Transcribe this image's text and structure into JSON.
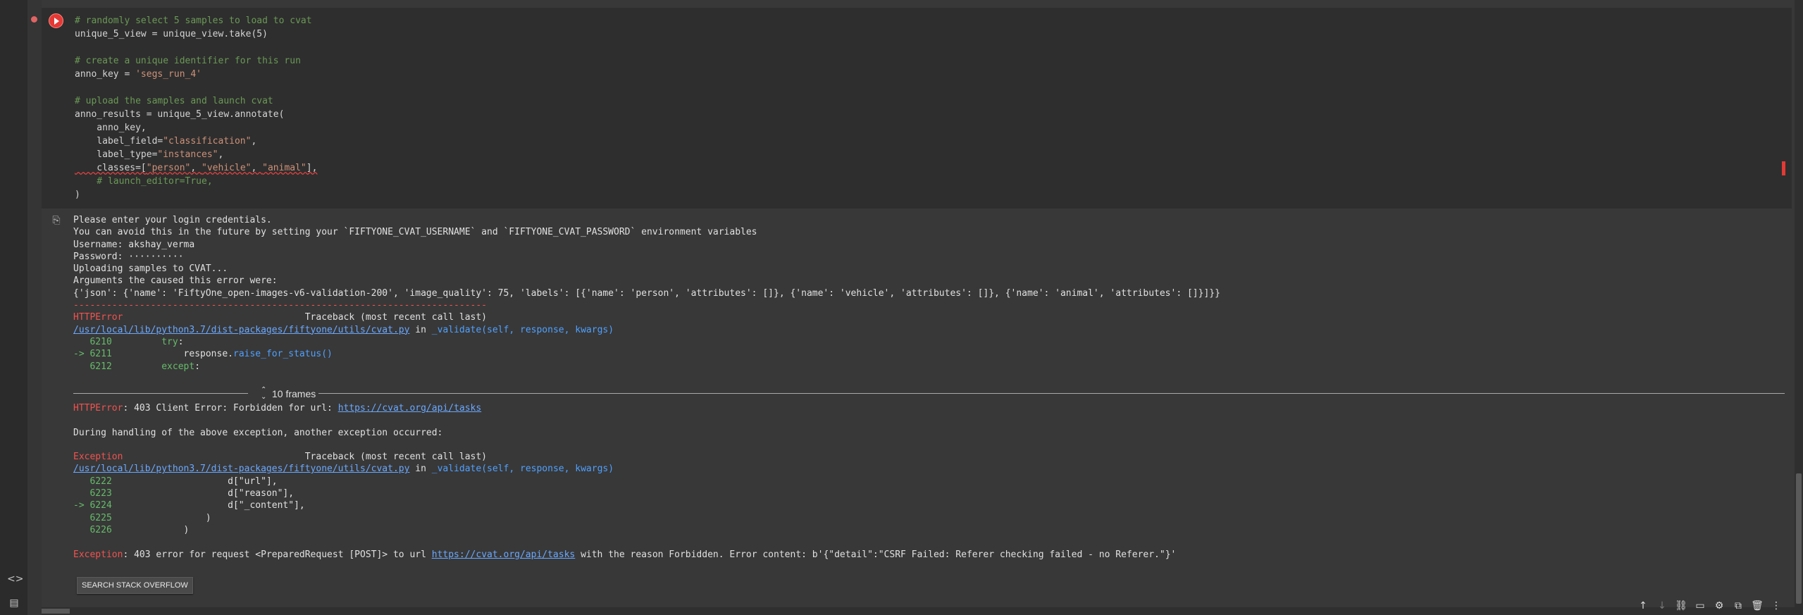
{
  "sidebar": {
    "icons": [
      "code-snippets-icon",
      "terminal-icon"
    ]
  },
  "cell": {
    "code_lines": [
      {
        "parts": [
          {
            "t": "# randomly select 5 samples to load to cvat",
            "c": "comment"
          }
        ]
      },
      {
        "parts": [
          {
            "t": "unique_5_view = unique_view.take(5)",
            "c": ""
          }
        ]
      },
      {
        "parts": [
          {
            "t": "",
            "c": ""
          }
        ]
      },
      {
        "parts": [
          {
            "t": "# create a unique identifier for this run",
            "c": "comment"
          }
        ]
      },
      {
        "parts": [
          {
            "t": "anno_key = ",
            "c": ""
          },
          {
            "t": "'segs_run_4'",
            "c": "str"
          }
        ]
      },
      {
        "parts": [
          {
            "t": "",
            "c": ""
          }
        ]
      },
      {
        "parts": [
          {
            "t": "# upload the samples and launch cvat",
            "c": "comment"
          }
        ]
      },
      {
        "parts": [
          {
            "t": "anno_results = unique_5_view.annotate(",
            "c": ""
          }
        ]
      },
      {
        "parts": [
          {
            "t": "    anno_key,",
            "c": ""
          }
        ]
      },
      {
        "parts": [
          {
            "t": "    label_field=",
            "c": ""
          },
          {
            "t": "\"classification\"",
            "c": "str"
          },
          {
            "t": ",",
            "c": ""
          }
        ]
      },
      {
        "parts": [
          {
            "t": "    label_type=",
            "c": ""
          },
          {
            "t": "\"instances\"",
            "c": "str"
          },
          {
            "t": ",",
            "c": ""
          }
        ]
      },
      {
        "parts": [
          {
            "t": "    classes=[",
            "c": "sq"
          },
          {
            "t": "\"person\"",
            "c": "sqstr"
          },
          {
            "t": ", ",
            "c": "sq"
          },
          {
            "t": "\"vehicle\"",
            "c": "sqstr"
          },
          {
            "t": ", ",
            "c": "sq"
          },
          {
            "t": "\"animal\"",
            "c": "sqstr"
          },
          {
            "t": "],",
            "c": "sq"
          }
        ]
      },
      {
        "parts": [
          {
            "t": "    # launch_editor=True,",
            "c": "comment"
          }
        ]
      },
      {
        "parts": [
          {
            "t": ")",
            "c": ""
          }
        ]
      }
    ]
  },
  "output": {
    "block1": [
      {
        "parts": [
          {
            "t": "Please enter your login credentials.",
            "c": ""
          }
        ]
      },
      {
        "parts": [
          {
            "t": "You can avoid this in the future by setting your `FIFTYONE_CVAT_USERNAME` and `FIFTYONE_CVAT_PASSWORD` environment variables",
            "c": ""
          }
        ]
      },
      {
        "parts": [
          {
            "t": "Username: akshay_verma",
            "c": ""
          }
        ]
      },
      {
        "parts": [
          {
            "t": "Password: ··········",
            "c": ""
          }
        ]
      },
      {
        "parts": [
          {
            "t": "Uploading samples to CVAT...",
            "c": ""
          }
        ]
      },
      {
        "parts": [
          {
            "t": "Arguments the caused this error were:",
            "c": ""
          }
        ]
      },
      {
        "parts": [
          {
            "t": "{'json': {'name': 'FiftyOne_open-images-v6-validation-200', 'image_quality': 75, 'labels': [{'name': 'person', 'attributes': []}, {'name': 'vehicle', 'attributes': []}, {'name': 'animal', 'attributes': []}]}}",
            "c": ""
          }
        ]
      },
      {
        "parts": [
          {
            "t": "---------------------------------------------------------------------------",
            "c": "red"
          }
        ]
      },
      {
        "parts": [
          {
            "t": "HTTPError",
            "c": "red"
          },
          {
            "t": "                                 Traceback (most recent call last)",
            "c": ""
          }
        ]
      },
      {
        "parts": [
          {
            "t": "/usr/local/lib/python3.7/dist-packages/fiftyone/utils/cvat.py",
            "c": "link"
          },
          {
            "t": " in ",
            "c": ""
          },
          {
            "t": "_validate",
            "c": "blue"
          },
          {
            "t": "(self, response, kwargs)",
            "c": "blue"
          }
        ]
      },
      {
        "parts": [
          {
            "t": "   6210         ",
            "c": "green"
          },
          {
            "t": "try",
            "c": "green"
          },
          {
            "t": ":",
            "c": ""
          }
        ]
      },
      {
        "parts": [
          {
            "t": "-> 6211             ",
            "c": "green"
          },
          {
            "t": "response",
            "c": ""
          },
          {
            "t": ".",
            "c": ""
          },
          {
            "t": "raise_for_status",
            "c": "blue"
          },
          {
            "t": "()",
            "c": "blue"
          }
        ]
      },
      {
        "parts": [
          {
            "t": "   6212         ",
            "c": "green"
          },
          {
            "t": "except",
            "c": "green"
          },
          {
            "t": ":",
            "c": ""
          }
        ]
      }
    ],
    "frames_label": "10 frames",
    "block2": [
      {
        "parts": [
          {
            "t": "HTTPError",
            "c": "red"
          },
          {
            "t": ": 403 Client Error: Forbidden for url: ",
            "c": ""
          },
          {
            "t": "https://cvat.org/api/tasks",
            "c": "link"
          }
        ]
      },
      {
        "parts": [
          {
            "t": "",
            "c": ""
          }
        ]
      },
      {
        "parts": [
          {
            "t": "During handling of the above exception, another exception occurred:",
            "c": ""
          }
        ]
      },
      {
        "parts": [
          {
            "t": "",
            "c": ""
          }
        ]
      },
      {
        "parts": [
          {
            "t": "Exception",
            "c": "red"
          },
          {
            "t": "                                 Traceback (most recent call last)",
            "c": ""
          }
        ]
      },
      {
        "parts": [
          {
            "t": "/usr/local/lib/python3.7/dist-packages/fiftyone/utils/cvat.py",
            "c": "link"
          },
          {
            "t": " in ",
            "c": ""
          },
          {
            "t": "_validate",
            "c": "blue"
          },
          {
            "t": "(self, response, kwargs)",
            "c": "blue"
          }
        ]
      },
      {
        "parts": [
          {
            "t": "   6222                     ",
            "c": "green"
          },
          {
            "t": "d[\"url\"],",
            "c": ""
          }
        ]
      },
      {
        "parts": [
          {
            "t": "   6223                     ",
            "c": "green"
          },
          {
            "t": "d[\"reason\"],",
            "c": ""
          }
        ]
      },
      {
        "parts": [
          {
            "t": "-> 6224                     ",
            "c": "green"
          },
          {
            "t": "d[\"_content\"],",
            "c": ""
          }
        ]
      },
      {
        "parts": [
          {
            "t": "   6225                 ",
            "c": "green"
          },
          {
            "t": ")",
            "c": ""
          }
        ]
      },
      {
        "parts": [
          {
            "t": "   6226             ",
            "c": "green"
          },
          {
            "t": ")",
            "c": ""
          }
        ]
      },
      {
        "parts": [
          {
            "t": "",
            "c": ""
          }
        ]
      },
      {
        "parts": [
          {
            "t": "Exception",
            "c": "red"
          },
          {
            "t": ": 403 error for request <PreparedRequest [POST]> to url ",
            "c": ""
          },
          {
            "t": "https://cvat.org/api/tasks",
            "c": "link"
          },
          {
            "t": " with the reason Forbidden. Error content: b'{\"detail\":\"CSRF Failed: Referer checking failed - no Referer.\"}'",
            "c": ""
          }
        ]
      }
    ],
    "so_button": "SEARCH STACK OVERFLOW"
  },
  "toolbar": {
    "icons": [
      "move-up-icon",
      "move-down-icon",
      "link-icon",
      "comment-icon",
      "settings-icon",
      "mirror-cell-icon",
      "delete-icon",
      "more-icon"
    ]
  }
}
